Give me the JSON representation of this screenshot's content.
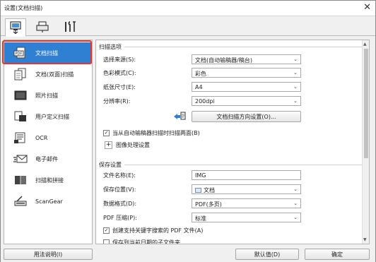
{
  "window": {
    "title": "设置(文档扫描)",
    "close_glyph": "✕"
  },
  "top_tabs": [
    {
      "name": "scan-from-computer",
      "icon": "computer-scan-icon"
    },
    {
      "name": "scan-from-panel",
      "icon": "scanner-panel-icon"
    },
    {
      "name": "general-settings",
      "icon": "tools-icon"
    }
  ],
  "sidebar": {
    "items": [
      {
        "label": "文档扫描",
        "icon": "pdf-document-icon",
        "selected": true
      },
      {
        "label": "文档(双面)扫描",
        "icon": "duplex-document-icon"
      },
      {
        "label": "照片扫描",
        "icon": "photo-icon"
      },
      {
        "label": "用户定义扫描",
        "icon": "custom-scan-icon"
      },
      {
        "label": "OCR",
        "icon": "ocr-icon"
      },
      {
        "label": "电子邮件",
        "icon": "email-icon"
      },
      {
        "label": "扫描和拼接",
        "icon": "stitch-icon"
      },
      {
        "label": "ScanGear",
        "icon": "scangear-icon"
      }
    ]
  },
  "scan_options": {
    "title": "扫描选项",
    "source_label": "选择来源(S):",
    "source_value": "文档(自动输稿器/稿台)",
    "color_label": "色彩模式(C):",
    "color_value": "彩色",
    "paper_label": "纸张尺寸(E):",
    "paper_value": "A4",
    "resolution_label": "分辨率(R):",
    "resolution_value": "200dpi",
    "orientation_button": "文档扫描方向设置(O)...",
    "duplex_checkbox": "当从自动输稿器扫描时扫描两面(B)",
    "duplex_checked": true,
    "image_processing": "图像处理设置"
  },
  "save_settings": {
    "title": "保存设置",
    "filename_label": "文件名称(E):",
    "filename_value": "IMG",
    "location_label": "保存位置(V):",
    "location_value": "文档",
    "format_label": "数据格式(D):",
    "format_value": "PDF(多页)",
    "compression_label": "PDF 压缩(P):",
    "compression_value": "标准",
    "searchable_checkbox": "创建支持关键字搜索的 PDF 文件(A)",
    "searchable_checked": true,
    "subfolder_checkbox": "保存到当前日期的子文件夹",
    "subfolder_checked": false
  },
  "bottom": {
    "help_button": "用法说明(I)",
    "defaults_button": "默认值(D)",
    "ok_button": "确定"
  }
}
